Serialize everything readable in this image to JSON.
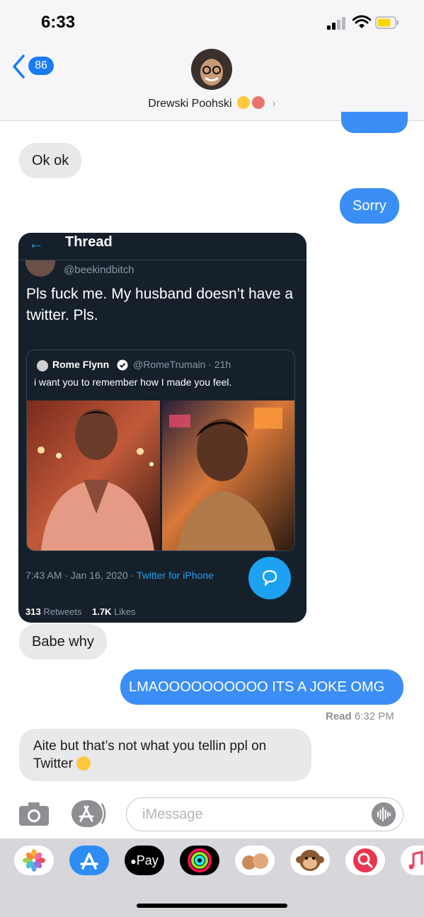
{
  "status_bar": {
    "time": "6:33"
  },
  "header": {
    "back_count": "86",
    "contact_name": "Drewski Poohski"
  },
  "messages": [
    {
      "from": "received",
      "text": "Ok ok"
    },
    {
      "from": "sent",
      "text": "Sorry"
    },
    {
      "from": "received",
      "text": "Babe why"
    },
    {
      "from": "sent",
      "text": "LMAOOOOOOOOOO ITS A JOKE OMG"
    },
    {
      "from": "received",
      "text": "Aite but that’s not what you tellin ppl on Twitter"
    }
  ],
  "read_receipt": {
    "label": "Read",
    "time": "6:32 PM"
  },
  "tweet": {
    "header": "Thread",
    "handle": "@beekindbitch",
    "text": "Pls fuck me. My husband doesn’t have a twitter. Pls.",
    "quoted": {
      "name": "Rome Flynn",
      "handle": "@RomeTrumain · 21h",
      "text": "i want you to remember how I made you feel."
    },
    "timestamp": "7:43 AM · Jan 16, 2020 · ",
    "source": "Twitter for iPhone",
    "retweets_count": "313",
    "retweets_label": "Retweets",
    "likes_count": "1.7K",
    "likes_label": "Likes"
  },
  "composer": {
    "placeholder": "iMessage"
  },
  "app_drawer": [
    "photos-app",
    "app-store",
    "apple-pay",
    "activity",
    "memoji-stickers",
    "animoji",
    "search-images",
    "music"
  ],
  "app_drawer_labels": {
    "apple_pay": "Pay"
  },
  "colors": {
    "sent_bubble": "#3a8ef6",
    "received_bubble": "#e9e9eb",
    "tweet_bg": "#15202b",
    "twitter_blue": "#1da1f2"
  }
}
